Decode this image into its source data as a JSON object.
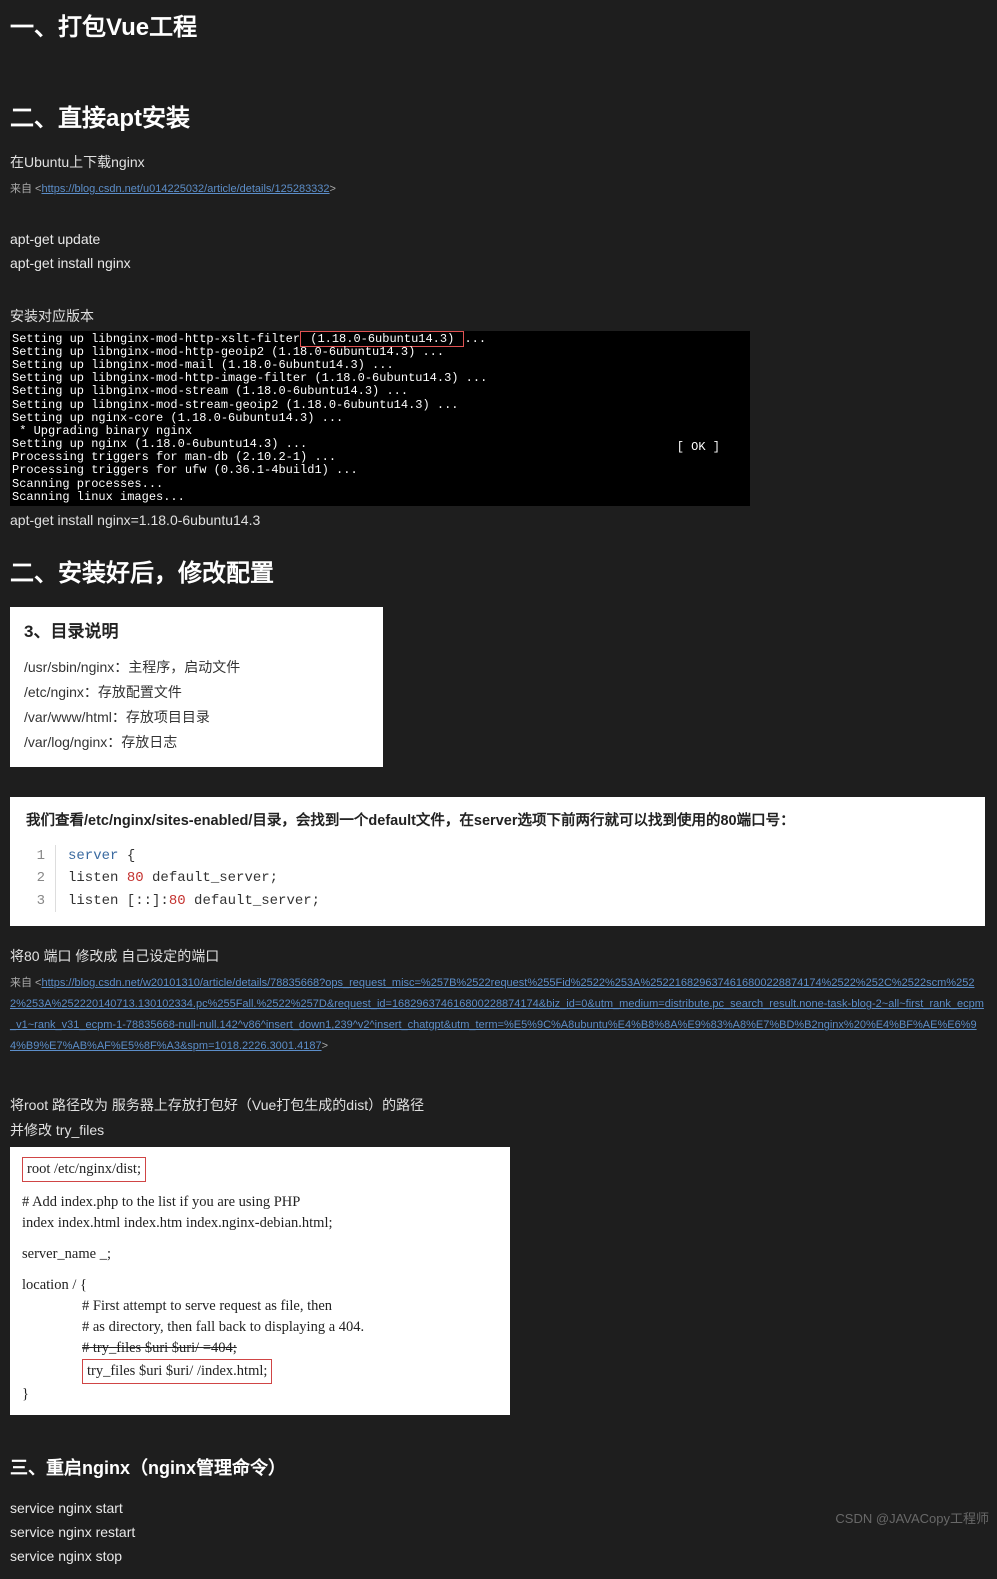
{
  "h_vue": "一、打包Vue工程",
  "h_apt": "二、直接apt安装",
  "ubuntu_dl": "在Ubuntu上下载nginx",
  "src_label": "来自 <",
  "src_close": ">",
  "link1": "https://blog.csdn.net/u014225032/article/details/125283332",
  "cmds": {
    "update": "apt-get update",
    "install": "apt-get install nginx"
  },
  "install_ver": "安装对应版本",
  "terminal_head": "Setting up libnginx-mod-http-xslt-filter",
  "terminal_ver": " (1.18.0-6ubuntu14.3) ",
  "terminal_dots": "...",
  "terminal_rest": "Setting up libnginx-mod-http-geoip2 (1.18.0-6ubuntu14.3) ...\nSetting up libnginx-mod-mail (1.18.0-6ubuntu14.3) ...\nSetting up libnginx-mod-http-image-filter (1.18.0-6ubuntu14.3) ...\nSetting up libnginx-mod-stream (1.18.0-6ubuntu14.3) ...\nSetting up libnginx-mod-stream-geoip2 (1.18.0-6ubuntu14.3) ...\nSetting up nginx-core (1.18.0-6ubuntu14.3) ...\n * Upgrading binary nginx\nSetting up nginx (1.18.0-6ubuntu14.3) ...\nProcessing triggers for man-db (2.10.2-1) ...\nProcessing triggers for ufw (0.36.1-4build1) ...\nScanning processes...\nScanning linux images...",
  "ok_text": "[ OK ]",
  "install_ver_cmd": "apt-get install nginx=1.18.0-6ubuntu14.3",
  "h_config": "二、安装好后，修改配置",
  "dir_title": "3、目录说明",
  "dirs": {
    "d1": "/usr/sbin/nginx：主程序，启动文件",
    "d2": "/etc/nginx：存放配置文件",
    "d3": "/var/www/html：存放项目目录",
    "d4": "/var/log/nginx：存放日志"
  },
  "sites_desc": "我们查看/etc/nginx/sites-enabled/目录，会找到一个default文件，在server选项下前两行就可以找到使用的80端口号：",
  "code": {
    "l1a": "server",
    "l1b": " {",
    "l2a": "        listen ",
    "l2b": "80",
    "l2c": " default_server;",
    "l3a": "        listen [::]:",
    "l3b": "80",
    "l3c": " default_server;"
  },
  "port_change": "将80 端口 修改成 自己设定的端口",
  "link2": "https://blog.csdn.net/w20101310/article/details/78835668?ops_request_misc=%257B%2522request%255Fid%2522%253A%2522168296374616800228874174%2522%252C%2522scm%2522%253A%252220140713.130102334.pc%255Fall.%2522%257D&request_id=168296374616800228874174&biz_id=0&utm_medium=distribute.pc_search_result.none-task-blog-2~all~first_rank_ecpm_v1~rank_v31_ecpm-1-78835668-null-null.142^v86^insert_down1,239^v2^insert_chatgpt&utm_term=%E5%9C%A8ubuntu%E4%B8%8A%E9%83%A8%E7%BD%B2nginx%20%E4%BF%AE%E6%94%B9%E7%AB%AF%E5%8F%A3&spm=1018.2226.3001.4187",
  "root_change": "将root 路径改为 服务器上存放打包好（Vue打包生成的dist）的路径",
  "tryfiles_change": "并修改 try_files",
  "cfg": {
    "root": "root /etc/nginx/dist;",
    "php1": "# Add index.php to the list if you are using PHP",
    "php2": "index index.html index.htm index.nginx-debian.html;",
    "srv": "server_name _;",
    "loc": "location / {",
    "c1": "# First attempt to serve request as file, then",
    "c2": "# as directory, then fall back to displaying a 404.",
    "c3": "# try_files $uri $uri/ =404;",
    "try": "try_files $uri $uri/ /index.html;",
    "close": "}"
  },
  "h_restart": "三、重启nginx（nginx管理命令）",
  "svc": {
    "start": "service nginx start",
    "restart": "service nginx restart",
    "stop": "service nginx stop"
  },
  "watermark": "CSDN @JAVACopy工程师"
}
